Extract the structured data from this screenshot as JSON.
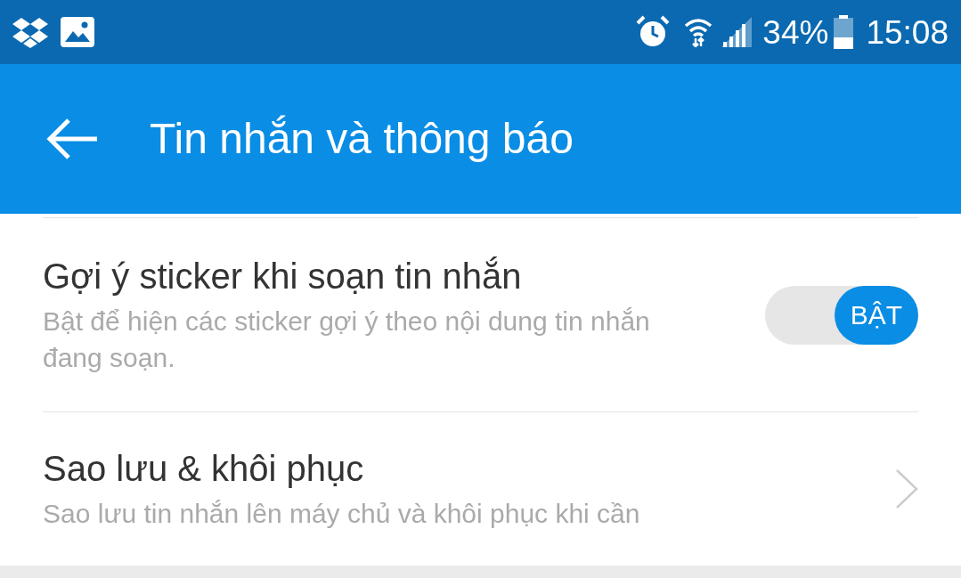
{
  "status_bar": {
    "battery": "34%",
    "time": "15:08"
  },
  "app_bar": {
    "title": "Tin nhắn và thông báo"
  },
  "settings": [
    {
      "kind": "toggle",
      "title": "Gợi ý sticker khi soạn tin nhắn",
      "subtitle": "Bật để hiện các sticker gợi ý theo nội dung tin nhắn đang soạn.",
      "on": true,
      "toggle_label": "BẬT"
    },
    {
      "kind": "link",
      "title": "Sao lưu & khôi phục",
      "subtitle": "Sao lưu tin nhắn lên máy chủ và khôi phục khi cần"
    }
  ]
}
